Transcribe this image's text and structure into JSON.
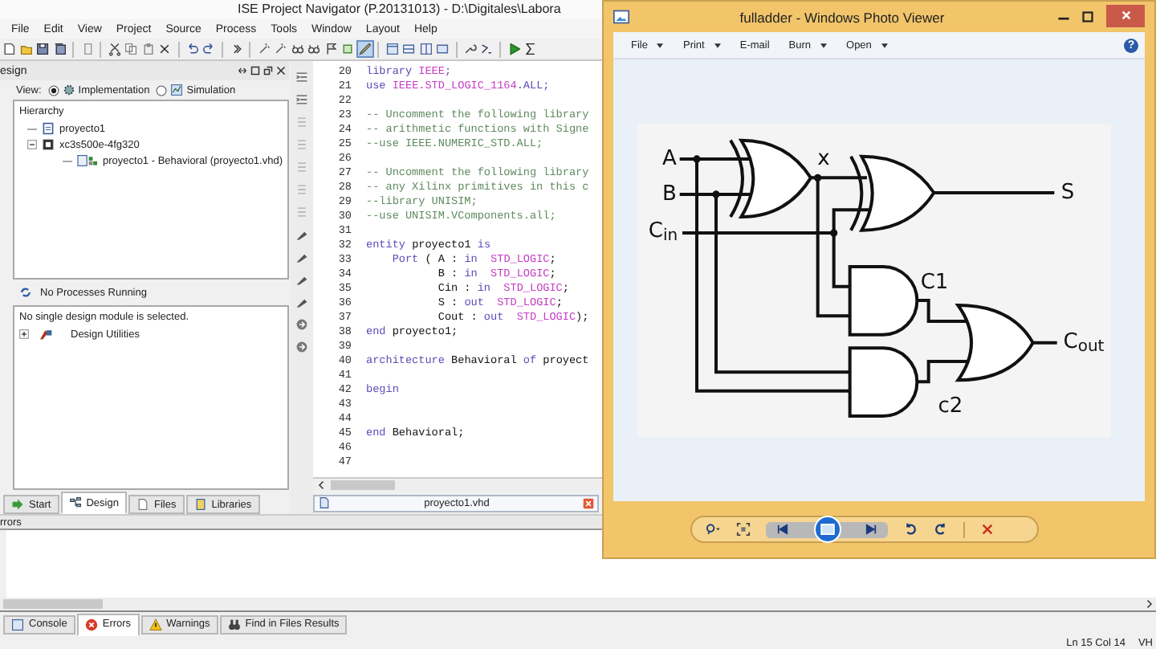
{
  "ise": {
    "title": "ISE Project Navigator (P.20131013) - D:\\Digitales\\Labora",
    "menu": [
      "File",
      "Edit",
      "View",
      "Project",
      "Source",
      "Process",
      "Tools",
      "Window",
      "Layout",
      "Help"
    ],
    "design_panel": {
      "title": "esign",
      "view_label": "View:",
      "view_options": [
        {
          "label": "Implementation",
          "selected": true
        },
        {
          "label": "Simulation",
          "selected": false
        }
      ],
      "hierarchy_label": "Hierarchy",
      "tree": [
        {
          "label": "proyecto1",
          "kind": "project"
        },
        {
          "label": "xc3s500e-4fg320",
          "kind": "device",
          "expanded": true,
          "children": [
            {
              "label": "proyecto1 - Behavioral (proyecto1.vhd)",
              "kind": "source"
            }
          ]
        }
      ],
      "process_status": "No Processes Running",
      "process_message": "No single design module is selected.",
      "process_tree": [
        {
          "label": "Design Utilities",
          "kind": "utilities",
          "expanded": false
        }
      ],
      "tabs": [
        {
          "label": "Start",
          "kind": "start",
          "selected": false
        },
        {
          "label": "Design",
          "kind": "design",
          "selected": true
        },
        {
          "label": "Files",
          "kind": "files",
          "selected": false
        },
        {
          "label": "Libraries",
          "kind": "libraries",
          "selected": false
        }
      ]
    },
    "editor": {
      "lines": [
        {
          "number": "20",
          "tokens": [
            {
              "kind": "keyword",
              "text": "library "
            },
            {
              "kind": "type",
              "text": "IEEE"
            },
            {
              "kind": "keyword",
              "text": ";"
            }
          ]
        },
        {
          "number": "21",
          "tokens": [
            {
              "kind": "keyword",
              "text": "use "
            },
            {
              "kind": "type",
              "text": "IEEE.STD_LOGIC_1164"
            },
            {
              "kind": "keyword",
              "text": ".ALL;"
            }
          ]
        },
        {
          "number": "22"
        },
        {
          "number": "23",
          "tokens": [
            {
              "kind": "comment",
              "text": "-- Uncomment the following library"
            }
          ]
        },
        {
          "number": "24",
          "tokens": [
            {
              "kind": "comment",
              "text": "-- arithmetic functions with Signe"
            }
          ]
        },
        {
          "number": "25",
          "tokens": [
            {
              "kind": "comment",
              "text": "--use IEEE.NUMERIC_STD.ALL;"
            }
          ]
        },
        {
          "number": "26"
        },
        {
          "number": "27",
          "tokens": [
            {
              "kind": "comment",
              "text": "-- Uncomment the following library"
            }
          ]
        },
        {
          "number": "28",
          "tokens": [
            {
              "kind": "comment",
              "text": "-- any Xilinx primitives in this c"
            }
          ]
        },
        {
          "number": "29",
          "tokens": [
            {
              "kind": "comment",
              "text": "--library UNISIM;"
            }
          ]
        },
        {
          "number": "30",
          "tokens": [
            {
              "kind": "comment",
              "text": "--use UNISIM.VComponents.all;"
            }
          ]
        },
        {
          "number": "31"
        },
        {
          "number": "32",
          "tokens": [
            {
              "kind": "keyword",
              "text": "entity"
            },
            {
              "kind": "plain",
              "text": " proyecto1 "
            },
            {
              "kind": "keyword",
              "text": "is"
            }
          ]
        },
        {
          "number": "33",
          "tokens": [
            {
              "kind": "keyword",
              "text": "    Port"
            },
            {
              "kind": "plain",
              "text": " ( A : "
            },
            {
              "kind": "keyword",
              "text": "in"
            },
            {
              "kind": "type",
              "text": "  STD_LOGIC"
            },
            {
              "kind": "plain",
              "text": ";"
            }
          ]
        },
        {
          "number": "34",
          "tokens": [
            {
              "kind": "plain",
              "text": "           B : "
            },
            {
              "kind": "keyword",
              "text": "in"
            },
            {
              "kind": "type",
              "text": "  STD_LOGIC"
            },
            {
              "kind": "plain",
              "text": ";"
            }
          ]
        },
        {
          "number": "35",
          "tokens": [
            {
              "kind": "plain",
              "text": "           Cin : "
            },
            {
              "kind": "keyword",
              "text": "in"
            },
            {
              "kind": "type",
              "text": "  STD_LOGIC"
            },
            {
              "kind": "plain",
              "text": ";"
            }
          ]
        },
        {
          "number": "36",
          "tokens": [
            {
              "kind": "plain",
              "text": "           S : "
            },
            {
              "kind": "keyword",
              "text": "out"
            },
            {
              "kind": "type",
              "text": "  STD_LOGIC"
            },
            {
              "kind": "plain",
              "text": ";"
            }
          ]
        },
        {
          "number": "37",
          "tokens": [
            {
              "kind": "plain",
              "text": "           Cout : "
            },
            {
              "kind": "keyword",
              "text": "out"
            },
            {
              "kind": "type",
              "text": "  STD_LOGIC"
            },
            {
              "kind": "plain",
              "text": ");"
            }
          ]
        },
        {
          "number": "38",
          "tokens": [
            {
              "kind": "keyword",
              "text": "end"
            },
            {
              "kind": "plain",
              "text": " proyecto1;"
            }
          ]
        },
        {
          "number": "39"
        },
        {
          "number": "40",
          "tokens": [
            {
              "kind": "keyword",
              "text": "architecture"
            },
            {
              "kind": "plain",
              "text": " Behavioral "
            },
            {
              "kind": "keyword",
              "text": "of"
            },
            {
              "kind": "plain",
              "text": " proyect"
            }
          ]
        },
        {
          "number": "41"
        },
        {
          "number": "42",
          "tokens": [
            {
              "kind": "keyword",
              "text": "begin"
            }
          ]
        },
        {
          "number": "43"
        },
        {
          "number": "44"
        },
        {
          "number": "45",
          "tokens": [
            {
              "kind": "keyword",
              "text": "end"
            },
            {
              "kind": "plain",
              "text": " Behavioral;"
            }
          ]
        },
        {
          "number": "46"
        },
        {
          "number": "47"
        }
      ],
      "file_tab": "proyecto1.vhd"
    },
    "errors_panel": {
      "title": "rrors",
      "tabs": [
        {
          "label": "Console",
          "kind": "console",
          "selected": false
        },
        {
          "label": "Errors",
          "kind": "errors",
          "selected": true
        },
        {
          "label": "Warnings",
          "kind": "warnings",
          "selected": false
        },
        {
          "label": "Find in Files Results",
          "kind": "find",
          "selected": false
        }
      ]
    },
    "status": [
      "Ln 15 Col 14",
      "VH"
    ]
  },
  "photo_viewer": {
    "title": "fulladder - Windows Photo Viewer",
    "menu": [
      {
        "label": "File",
        "dropdown": true
      },
      {
        "label": "Print",
        "dropdown": true
      },
      {
        "label": "E-mail",
        "dropdown": false
      },
      {
        "label": "Burn",
        "dropdown": true
      },
      {
        "label": "Open",
        "dropdown": true
      }
    ],
    "help": "?",
    "diagram_labels": [
      "A",
      "B",
      "C$_{in}$",
      "x",
      "S",
      "C1",
      "C$_{out}$",
      "c2"
    ]
  }
}
